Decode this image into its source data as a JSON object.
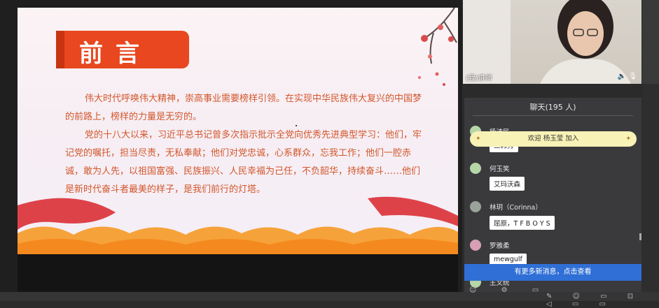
{
  "slide": {
    "title": "前言",
    "paragraphs": [
      "伟大时代呼唤伟大精神，崇高事业需要榜样引领。在实现中华民族伟大复兴的中国梦的前路上，榜样的力量是无穷的。",
      "党的十八大以来，习近平总书记曾多次指示批示全党向优秀先进典型学习：他们，牢记党的嘱托，担当尽责，无私奉献；他们对党忠诚，心系群众，忘我工作；他们一腔赤诚，敢为人先，以祖国富强、民族振兴、人民幸福为己任，不负韶华，持续奋斗……他们是新时代奋斗者最美的样子，是我们前行的灯塔。"
    ]
  },
  "webcam": {
    "label": "(我)讲师",
    "icons": [
      "speaker-icon",
      "microphone-icon"
    ],
    "icon_glyphs": "🔈 🎙"
  },
  "chat": {
    "header": "聊天(195 人)",
    "welcome": "欢迎 杨玉莹 加入",
    "messages": [
      {
        "name": "杨沛民",
        "text": "三韩秀"
      },
      {
        "name": "何玉笑",
        "text": "艾玛沃森"
      },
      {
        "name": "林玥（Corinna）",
        "text": "屈原，T F B O Y S"
      },
      {
        "name": "罗雅柔",
        "text": "mewgulf"
      },
      {
        "name": "王文统",
        "text": ""
      }
    ],
    "new_messages_notice": "有更多新消息，点击查看",
    "tool_glyphs": "☺ ⚙ ▭",
    "system_glyphs": "✎ ☺ ▭ ⊡ ◁ ▭ ▭"
  }
}
